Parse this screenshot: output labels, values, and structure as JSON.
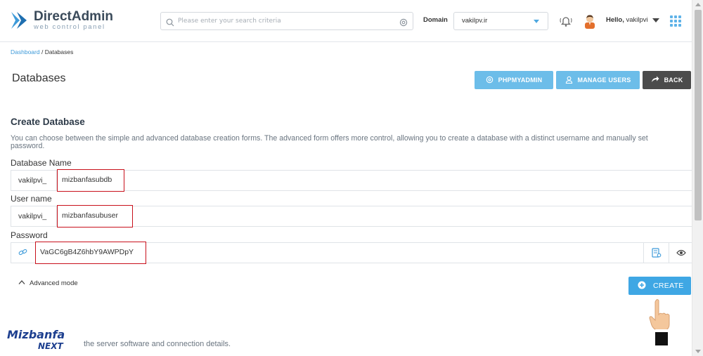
{
  "brand": {
    "title": "DirectAdmin",
    "subtitle": "web control panel"
  },
  "search": {
    "placeholder": "Please enter your search criteria",
    "value": ""
  },
  "domain": {
    "label": "Domain",
    "selected": "vakilpv.ir"
  },
  "user": {
    "hello": "Hello,",
    "name": "vakilpvi"
  },
  "breadcrumb": {
    "home": "Dashboard",
    "separator": "/",
    "current": "Databases"
  },
  "page": {
    "title": "Databases"
  },
  "actions": {
    "phpmyadmin": "PHPMYADMIN",
    "manage_users": "MANAGE USERS",
    "back": "BACK"
  },
  "form": {
    "title": "Create Database",
    "description": "You can choose between the simple and advanced database creation forms. The advanced form offers more control, allowing you to create a database with a distinct username and manually set password.",
    "db_name": {
      "label": "Database Name",
      "prefix": "vakilpvi_",
      "value": "mizbanfasubdb"
    },
    "user_name": {
      "label": "User name",
      "prefix": "vakilpvi_",
      "value": "mizbanfasubuser"
    },
    "password": {
      "label": "Password",
      "value": "VaGC6gB4Z6hbY9AWPDpY"
    },
    "advanced_mode": "Advanced mode",
    "create": "CREATE"
  },
  "watermark": {
    "line1": "Mizbanfa",
    "line2": "NEXT"
  },
  "footer": {
    "partial_text": "the server software and connection details."
  },
  "colors": {
    "accent": "#3fa7e4",
    "light_accent": "#6cbde9",
    "dark_button": "#4b4b4b",
    "highlight_border": "#c8101b"
  }
}
